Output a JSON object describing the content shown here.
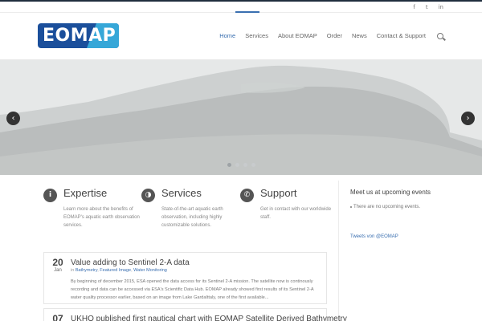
{
  "social": {
    "icons": [
      "facebook-icon",
      "twitter-icon",
      "linkedin-icon"
    ],
    "glyphs": [
      "f",
      "t",
      "in"
    ]
  },
  "logo": {
    "text": "EOMAP"
  },
  "nav": {
    "items": [
      "Home",
      "Services",
      "About EOMAP",
      "Order",
      "News",
      "Contact & Support"
    ],
    "active": "Home"
  },
  "slider": {
    "prev": "‹",
    "next": "›",
    "dots": 4,
    "active_dot": 0
  },
  "features": [
    {
      "icon": "info-icon",
      "glyph": "i",
      "title": "Expertise",
      "text": "Learn more about the benefits of EOMAP's aquatic earth observation services."
    },
    {
      "icon": "globe-icon",
      "glyph": "◑",
      "title": "Services",
      "text": "State-of-the-art aquatic earth observation, including highly customizable solutions."
    },
    {
      "icon": "phone-icon",
      "glyph": "✆",
      "title": "Support",
      "text": "Get in contact with our worldwide staff."
    }
  ],
  "sidebar": {
    "events_title": "Meet us at upcoming events",
    "events_item": "There are no upcoming events.",
    "tweets": "Tweets von @EOMAP"
  },
  "posts": [
    {
      "day": "20",
      "month": "Jan",
      "title": "Value adding to Sentinel 2-A data",
      "cats_prefix": "in",
      "cats": [
        "Bathymetry",
        "Featured Image",
        "Water Monitoring"
      ],
      "text": "By beginning of december 2015, ESA opened the data access for its Sentinel 2-A mission. The satellite now is continously recording and data can be accessed via ESA's Scientific Data Hub. EOMAP already showed first results of its Sentinel 2-A water quality processor earlier, based on an image from Lake Gardalttaly, one of the first available..."
    },
    {
      "day": "07",
      "month": "",
      "title": "UKHO published first nautical chart with EOMAP Satellite Derived Bathymetry"
    }
  ],
  "colors": {
    "accent": "#3a6fb0",
    "brand": "#1b4f9b",
    "brand_light": "#36a7d8"
  }
}
